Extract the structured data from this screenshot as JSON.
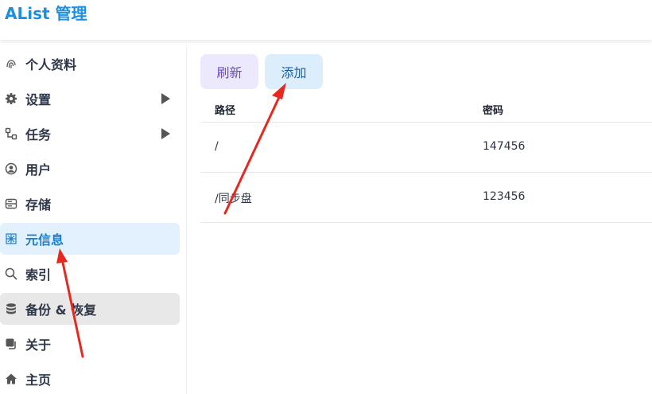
{
  "app": {
    "title": "AList 管理"
  },
  "sidebar": {
    "items": [
      {
        "label": "个人资料",
        "icon": "fingerprint-icon"
      },
      {
        "label": "设置",
        "icon": "gear-icon"
      },
      {
        "label": "任务",
        "icon": "tasks-icon"
      },
      {
        "label": "用户",
        "icon": "user-circle-icon"
      },
      {
        "label": "存储",
        "icon": "storage-icon"
      },
      {
        "label": "元信息",
        "icon": "meta-icon"
      },
      {
        "label": "索引",
        "icon": "search-icon"
      },
      {
        "label": "备份 & 恢复",
        "icon": "database-icon"
      },
      {
        "label": "关于",
        "icon": "copy-icon"
      },
      {
        "label": "主页",
        "icon": "home-icon"
      }
    ]
  },
  "toolbar": {
    "refresh_label": "刷新",
    "add_label": "添加"
  },
  "table": {
    "headers": [
      "路径",
      "密码"
    ],
    "rows": [
      {
        "path": "/",
        "password": "147456"
      },
      {
        "path": "/同步盘",
        "password": "123456"
      }
    ]
  },
  "colors": {
    "accent": "#1a8fe3",
    "active_bg": "#e2f1fd",
    "annotation": "#e8281f"
  }
}
